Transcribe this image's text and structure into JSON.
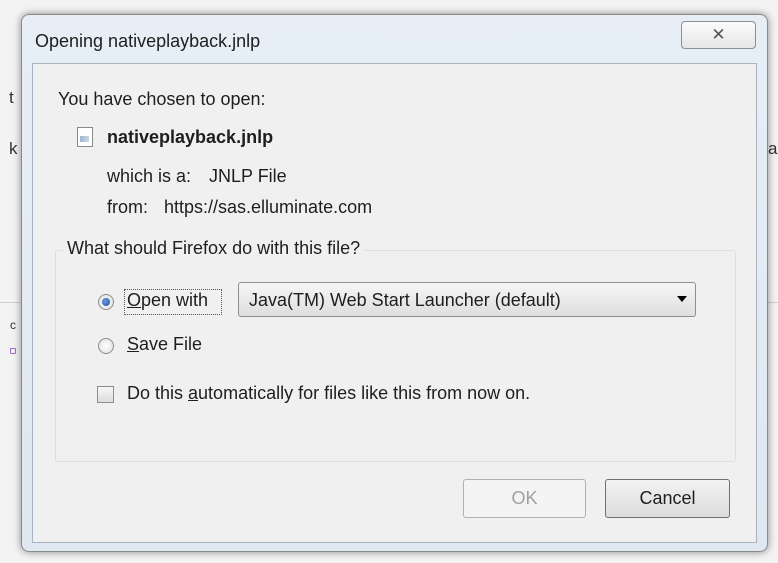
{
  "dialog": {
    "title": "Opening nativeplayback.jnlp",
    "close_glyph": "✕",
    "intro": "You have chosen to open:",
    "file_name": "nativeplayback.jnlp",
    "file_icon": "document-icon",
    "type_label": "which is a:",
    "type_value": "JNLP File",
    "from_label": "from:",
    "from_value": "https://sas.elluminate.com",
    "question": "What should Firefox do with this file?",
    "open_with": {
      "prefix": "",
      "accel": "O",
      "rest": "pen with",
      "selected": true
    },
    "app_select": {
      "value": "Java(TM) Web Start Launcher (default)"
    },
    "save_file": {
      "accel": "S",
      "rest": "ave File",
      "selected": false
    },
    "auto": {
      "prefix": "Do this ",
      "accel": "a",
      "rest": "utomatically for files like this from now on.",
      "checked": false
    },
    "ok_label": "OK",
    "ok_enabled": false,
    "cancel_label": "Cancel"
  },
  "background": {
    "left_chars": [
      "t",
      "k",
      "c"
    ],
    "right_chars": [
      "a"
    ]
  }
}
